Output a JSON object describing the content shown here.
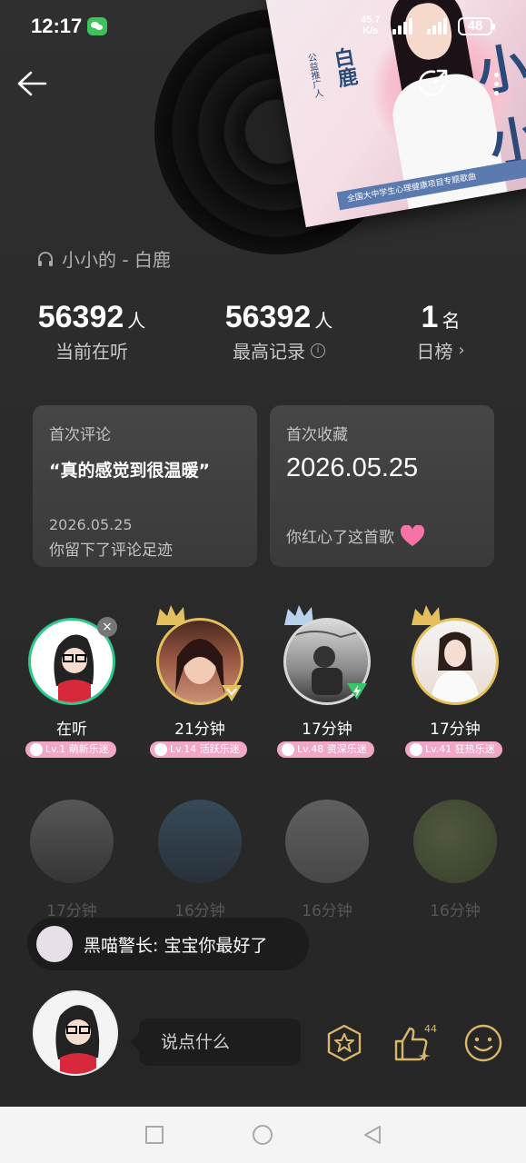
{
  "status_bar": {
    "time": "12:17",
    "net_speed_value": "45.7",
    "net_speed_unit": "K/s",
    "battery": "48"
  },
  "cover": {
    "title": "小小的",
    "artist": "白鹿",
    "artist_label": "公益推广人",
    "banner": "全国大中学生心理健康项目专题歌曲",
    "side_text": "全国大中学生心理健康项目"
  },
  "song": {
    "line": "小小的 - 白鹿"
  },
  "stats": [
    {
      "value": "56392",
      "unit": "人",
      "label": "当前在听"
    },
    {
      "value": "56392",
      "unit": "人",
      "label": "最高记录"
    },
    {
      "value": "1",
      "unit": "名",
      "label": "日榜"
    }
  ],
  "first_comment": {
    "title": "首次评论",
    "quote": "“真的感觉到很温暖”",
    "date": "2026.05.25",
    "footer": "你留下了评论足迹"
  },
  "first_favorite": {
    "title": "首次收藏",
    "date": "2026.05.25",
    "footer": "你红心了这首歌"
  },
  "listeners_row1": [
    {
      "time": "在听",
      "level": "Lv.1 萌新乐迷"
    },
    {
      "time": "21分钟",
      "level": "Lv.14 活跃乐迷"
    },
    {
      "time": "17分钟",
      "level": "Lv.48 资深乐迷"
    },
    {
      "time": "17分钟",
      "level": "Lv.41 狂热乐迷"
    }
  ],
  "listeners_row2": [
    {
      "time": "17分钟"
    },
    {
      "time": "16分钟"
    },
    {
      "time": "16分钟"
    },
    {
      "time": "16分钟"
    }
  ],
  "toast": {
    "name": "黑喵警长:",
    "message": "宝宝你最好了"
  },
  "comment_input": {
    "placeholder": "说点什么"
  },
  "like_count": "44",
  "colors": {
    "badge_pink": "#f0a8c6",
    "gold": "#d9b76a",
    "background": "#2b2b2b"
  }
}
